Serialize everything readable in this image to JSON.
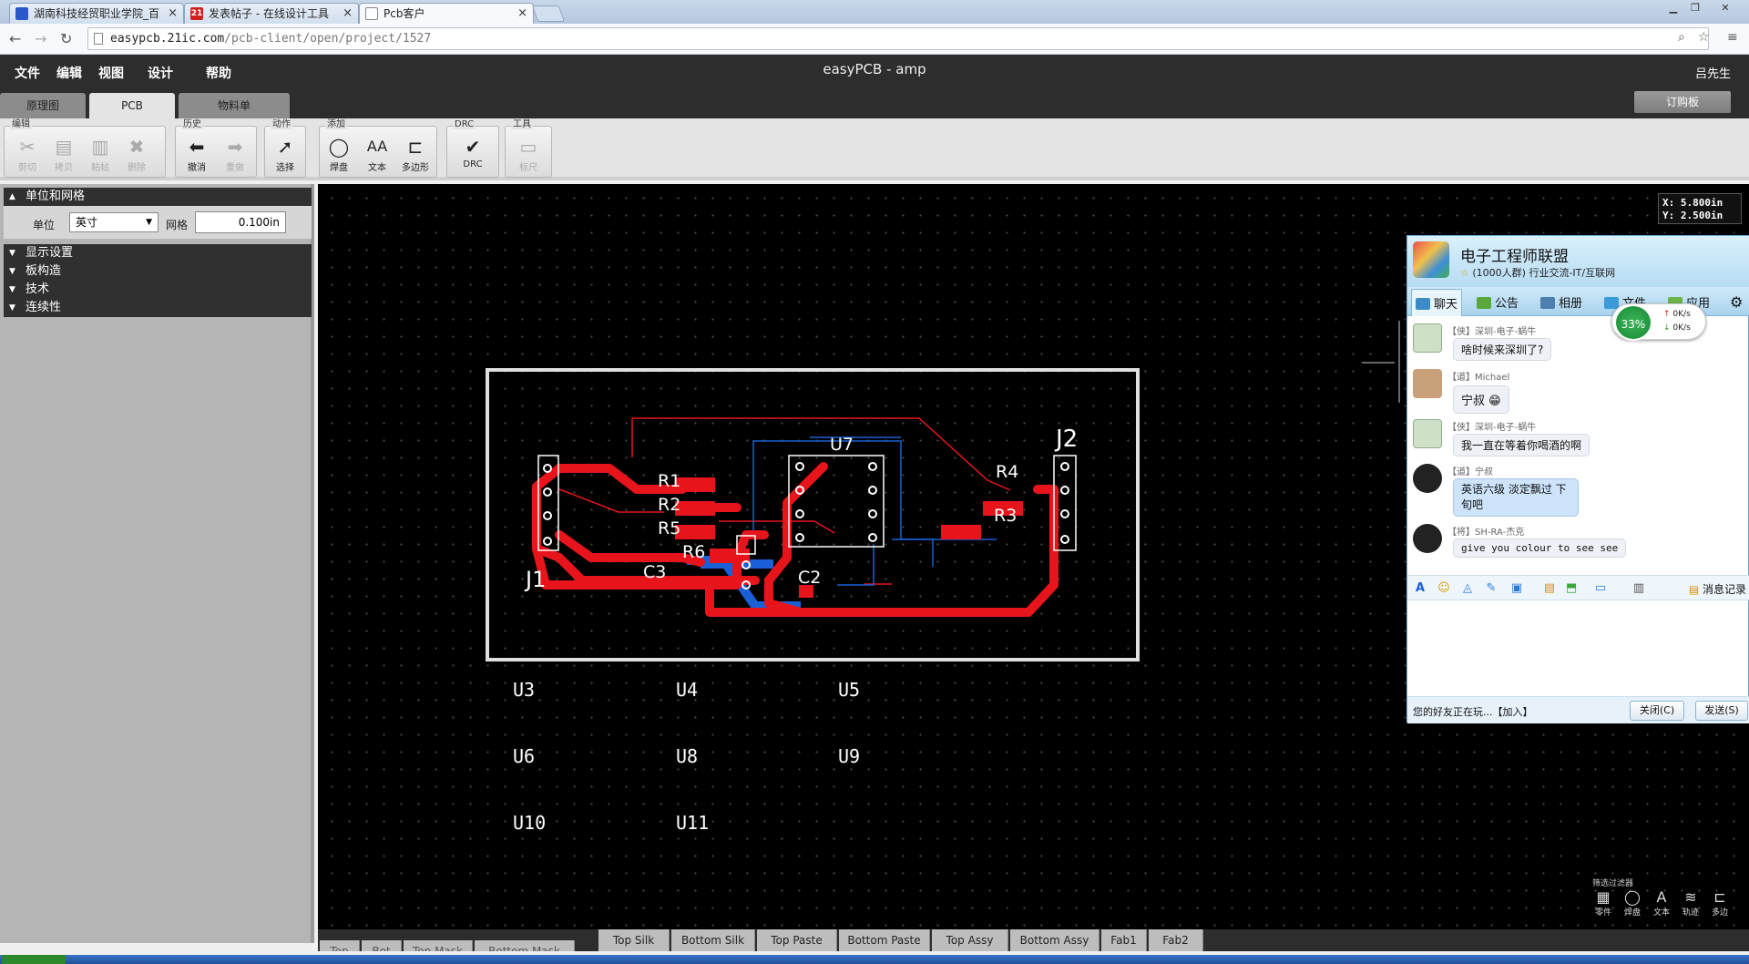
{
  "browser": {
    "tabs": [
      {
        "label": "湖南科技经贸职业学院_百",
        "icon_color": "#2a58c8"
      },
      {
        "label": "发表帖子 - 在线设计工具",
        "icon_color": "#d02020",
        "icon_text": "21"
      },
      {
        "label": "Pcb客户",
        "icon_color": "#ffffff"
      }
    ],
    "url_host": "easypcb.21ic.com",
    "url_path": "/pcb-client/open/project/1527"
  },
  "app": {
    "menus": [
      "文件",
      "编辑",
      "视图",
      "设计",
      "帮助"
    ],
    "title": "easyPCB - amp",
    "user": "吕先生",
    "view_tabs": [
      "原理图",
      "PCB",
      "物料单"
    ],
    "order_button": "订购板"
  },
  "toolbar": {
    "groups": [
      {
        "label": "编辑",
        "buttons": [
          {
            "label": "剪切",
            "icon": "scissors-icon"
          },
          {
            "label": "拷贝",
            "icon": "copy-icon"
          },
          {
            "label": "粘帖",
            "icon": "paste-icon"
          },
          {
            "label": "删除",
            "icon": "delete-icon"
          }
        ]
      },
      {
        "label": "历史",
        "buttons": [
          {
            "label": "撤消",
            "icon": "undo-icon"
          },
          {
            "label": "重做",
            "icon": "redo-icon"
          }
        ]
      },
      {
        "label": "动作",
        "buttons": [
          {
            "label": "选择",
            "icon": "pointer-icon"
          }
        ]
      },
      {
        "label": "添加",
        "buttons": [
          {
            "label": "焊盘",
            "icon": "pad-icon"
          },
          {
            "label": "文本",
            "icon": "text-icon"
          },
          {
            "label": "多边形",
            "icon": "polygon-icon"
          }
        ]
      },
      {
        "label": "DRC",
        "buttons": [
          {
            "label": "DRC",
            "icon": "check-icon"
          }
        ]
      },
      {
        "label": "工具",
        "buttons": [
          {
            "label": "标尺",
            "icon": "ruler-icon"
          }
        ]
      }
    ]
  },
  "left_panel": {
    "sections": [
      "单位和网格",
      "显示设置",
      "板构造",
      "技术",
      "连续性"
    ],
    "unit_label": "单位",
    "unit_value": "英寸",
    "grid_label": "网格",
    "grid_value": "0.100in"
  },
  "canvas": {
    "coord_x": "X: 5.800in",
    "coord_y": "Y: 2.500in",
    "board_labels": [
      "R1",
      "R2",
      "R5",
      "R6",
      "C3",
      "C2",
      "U7",
      "R4",
      "R3",
      "J1",
      "J2"
    ],
    "parts_outside": [
      "U3",
      "U4",
      "U5",
      "U6",
      "U8",
      "U9",
      "U10",
      "U11"
    ],
    "filters_title": "筛选过滤器",
    "filters": [
      {
        "label": "零件",
        "icon": "part-icon"
      },
      {
        "label": "焊盘",
        "icon": "pad-icon"
      },
      {
        "label": "文本",
        "icon": "text-icon"
      },
      {
        "label": "轨迹",
        "icon": "track-icon"
      },
      {
        "label": "多边",
        "icon": "polygon-icon"
      }
    ]
  },
  "layers": [
    "Top",
    "Bot",
    "Top Mask",
    "Bottom Mask",
    "Top Silk",
    "Bottom Silk",
    "Top Paste",
    "Bottom Paste",
    "Top Assy",
    "Bottom Assy",
    "Fab1",
    "Fab2"
  ],
  "chat": {
    "group_name": "电子工程师联盟",
    "group_sub": "(1000人群) 行业交流-IT/互联网",
    "tabs": [
      "聊天",
      "公告",
      "相册",
      "文件",
      "应用"
    ],
    "net_percent": "33%",
    "up_speed": "0K/s",
    "down_speed": "0K/s",
    "messages": [
      {
        "who": "【侠】深圳-电子-蜗牛",
        "text": "啥时候来深圳了?"
      },
      {
        "who": "【道】Michael",
        "text": "宁叔 😁"
      },
      {
        "who": "【侠】深圳-电子-蜗牛",
        "text": "我一直在等着你喝酒的啊"
      },
      {
        "who": "【道】宁叔",
        "text": "英语六级 淡定飘过 下旬吧"
      },
      {
        "who": "【将】SH-RA-杰克",
        "text": "give you colour to see see"
      }
    ],
    "history_label": "消息记录",
    "status": "您的好友正在玩...【加入】",
    "close_button": "关闭(C)",
    "send_button": "发送(S)"
  },
  "colors": {
    "top_copper": "#e8141c",
    "bottom_copper": "#1a5fd6",
    "silk": "#ffffff",
    "app_dark": "#2d2d2d"
  }
}
